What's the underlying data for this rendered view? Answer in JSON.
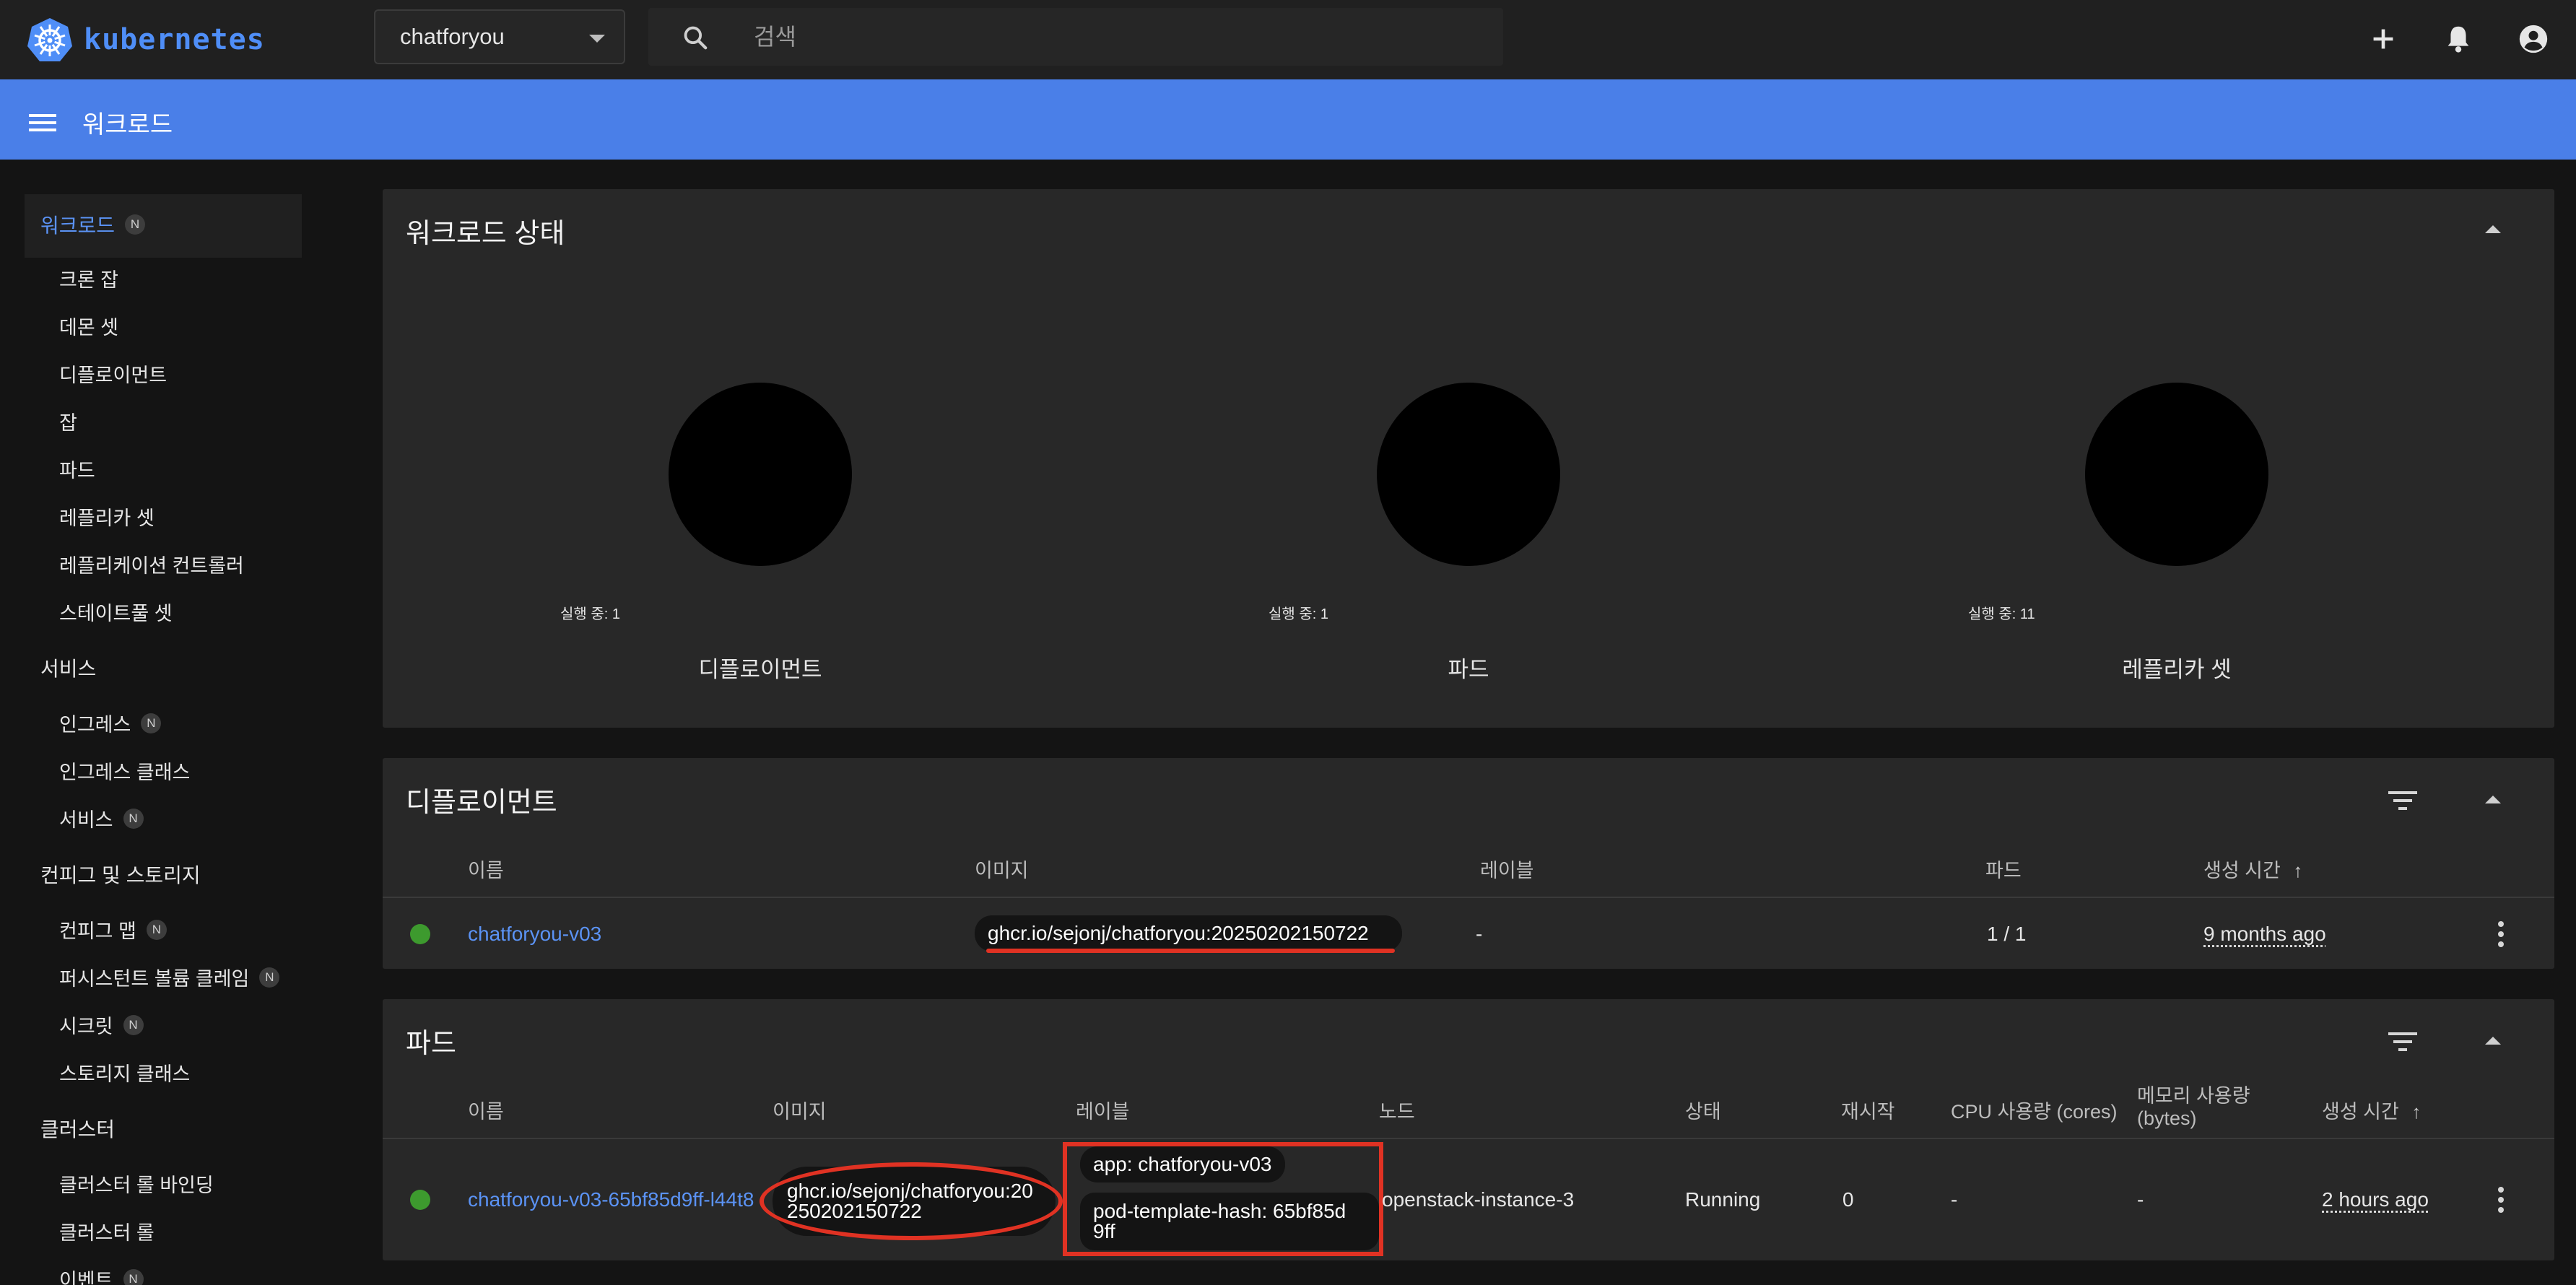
{
  "app": {
    "name": "kubernetes",
    "namespace": "chatforyou"
  },
  "search": {
    "placeholder": "검색"
  },
  "header": {
    "title": "워크로드"
  },
  "sidebar": {
    "workload": {
      "label": "워크로드",
      "badge": "N"
    },
    "workload_items": [
      "크론 잡",
      "데몬 셋",
      "디플로이먼트",
      "잡",
      "파드",
      "레플리카 셋",
      "레플리케이션 컨트롤러",
      "스테이트풀 셋"
    ],
    "service_section": "서비스",
    "service_items": [
      {
        "label": "인그레스",
        "badge": "N"
      },
      {
        "label": "인그레스 클래스",
        "badge": ""
      },
      {
        "label": "서비스",
        "badge": "N"
      }
    ],
    "config_section": "컨피그 및 스토리지",
    "config_items": [
      {
        "label": "컨피그 맵",
        "badge": "N"
      },
      {
        "label": "퍼시스턴트 볼륨 클레임",
        "badge": "N"
      },
      {
        "label": "시크릿",
        "badge": "N"
      },
      {
        "label": "스토리지 클래스",
        "badge": ""
      }
    ],
    "cluster_section": "클러스터",
    "cluster_items": [
      {
        "label": "클러스터 롤 바인딩",
        "badge": ""
      },
      {
        "label": "클러스터 롤",
        "badge": ""
      },
      {
        "label": "이벤트",
        "badge": "N"
      }
    ]
  },
  "workload_status": {
    "title": "워크로드 상태",
    "charts": [
      {
        "legend": "실행 중: 1",
        "label": "디플로이먼트"
      },
      {
        "legend": "실행 중: 1",
        "label": "파드"
      },
      {
        "legend": "실행 중: 11",
        "label": "레플리카 셋"
      }
    ]
  },
  "deployments": {
    "title": "디플로이먼트",
    "columns": [
      "이름",
      "이미지",
      "레이블",
      "파드",
      "생성 시간"
    ],
    "sort_arrow": "↑",
    "row": {
      "name": "chatforyou-v03",
      "image": "ghcr.io/sejonj/chatforyou:20250202150722",
      "labels": "-",
      "pods": "1 / 1",
      "created": "9 months ago",
      "status_color": "#3d9a2e"
    }
  },
  "pods": {
    "title": "파드",
    "columns": [
      "이름",
      "이미지",
      "레이블",
      "노드",
      "상태",
      "재시작",
      "CPU 사용량 (cores)",
      "메모리 사용량",
      "(bytes)",
      "생성 시간"
    ],
    "sort_arrow": "↑",
    "row": {
      "name": "chatforyou-v03-65bf85d9ff-l44t8",
      "image_line1": "ghcr.io/sejonj/chatforyou:20",
      "image_line2": "250202150722",
      "label1": "app: chatforyou-v03",
      "label2_line1": "pod-template-hash: 65bf85d",
      "label2_line2": "9ff",
      "node": "openstack-instance-3",
      "status": "Running",
      "restarts": "0",
      "cpu": "-",
      "memory": "-",
      "created": "2 hours ago",
      "status_color": "#3d9a2e"
    }
  },
  "colors": {
    "accent": "#4a7fe8",
    "link": "#5b93f5",
    "annotation": "#e03223",
    "running": "#3d9a2e"
  },
  "icons": [
    "kubernetes-logo-icon",
    "search-icon",
    "plus-icon",
    "bell-icon",
    "account-icon",
    "menu-icon",
    "filter-icon",
    "chevron-up-icon",
    "more-vert-icon",
    "arrow-up-icon"
  ]
}
